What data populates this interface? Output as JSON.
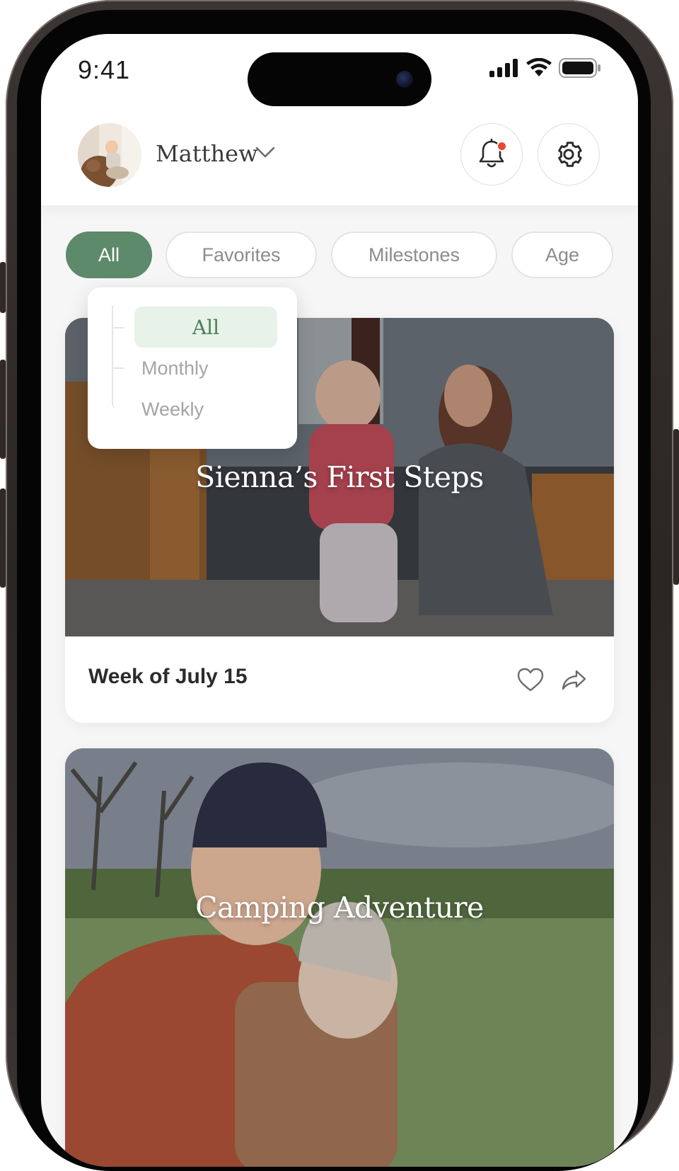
{
  "status_bar": {
    "time": "9:41"
  },
  "header": {
    "user_name": "Matthew"
  },
  "filters": {
    "chips": [
      "All",
      "Favorites",
      "Milestones",
      "Age"
    ],
    "active": "All"
  },
  "dropdown": {
    "options": [
      "All",
      "Monthly",
      "Weekly"
    ],
    "selected": "All"
  },
  "cards": [
    {
      "title": "Sienna’s First Steps",
      "subtitle": "Week of July 15",
      "favorited": false
    },
    {
      "title": "Camping Adventure"
    }
  ],
  "colors": {
    "accent": "#5d8a6a",
    "accent_light": "#e7f2e9",
    "notification_dot": "#e8472f"
  }
}
